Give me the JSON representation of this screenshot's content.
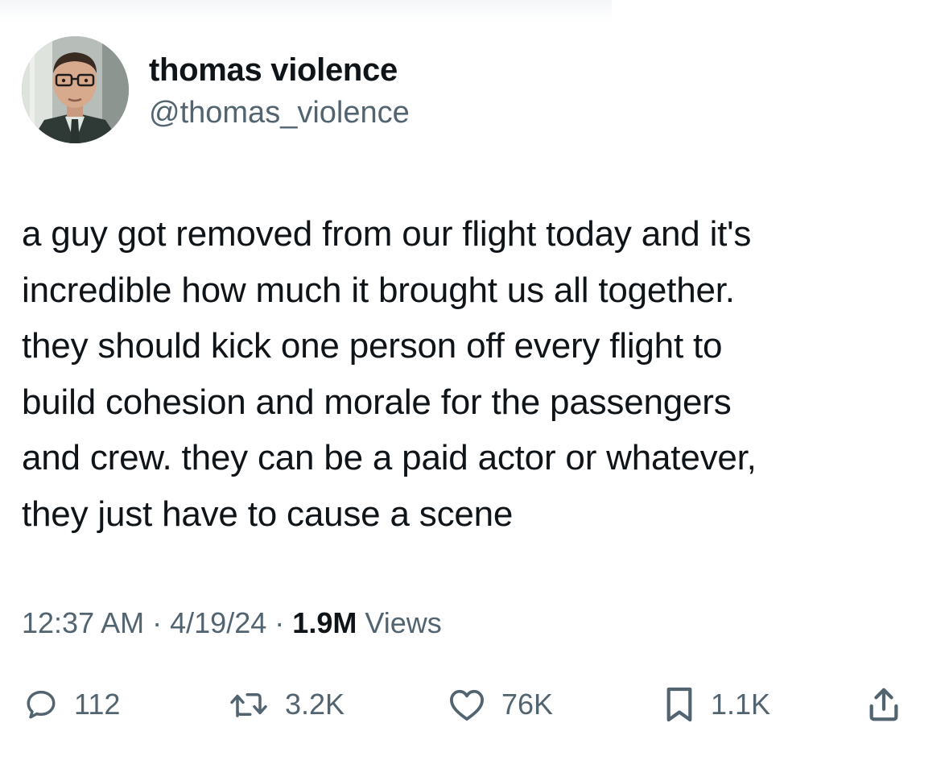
{
  "author": {
    "display_name": "thomas violence",
    "handle": "@thomas_violence"
  },
  "tweet": {
    "lines": [
      "a guy got removed from our flight today and it's",
      "incredible how much it brought us all together.",
      "they should kick one person off every flight to",
      "build cohesion and morale for the passengers",
      "and crew. they can be a paid actor or whatever,",
      "they just have to cause a scene"
    ]
  },
  "meta": {
    "time": "12:37 AM",
    "separator": "·",
    "date": "4/19/24",
    "views_count": "1.9M",
    "views_label": "Views"
  },
  "actions": {
    "reply": {
      "icon": "reply-icon",
      "count": "112"
    },
    "retweet": {
      "icon": "retweet-icon",
      "count": "3.2K"
    },
    "like": {
      "icon": "heart-icon",
      "count": "76K"
    },
    "bookmark": {
      "icon": "bookmark-icon",
      "count": "1.1K"
    },
    "share": {
      "icon": "share-icon"
    }
  },
  "colors": {
    "text_primary": "#0f1419",
    "text_secondary": "#536471",
    "background": "#ffffff"
  }
}
